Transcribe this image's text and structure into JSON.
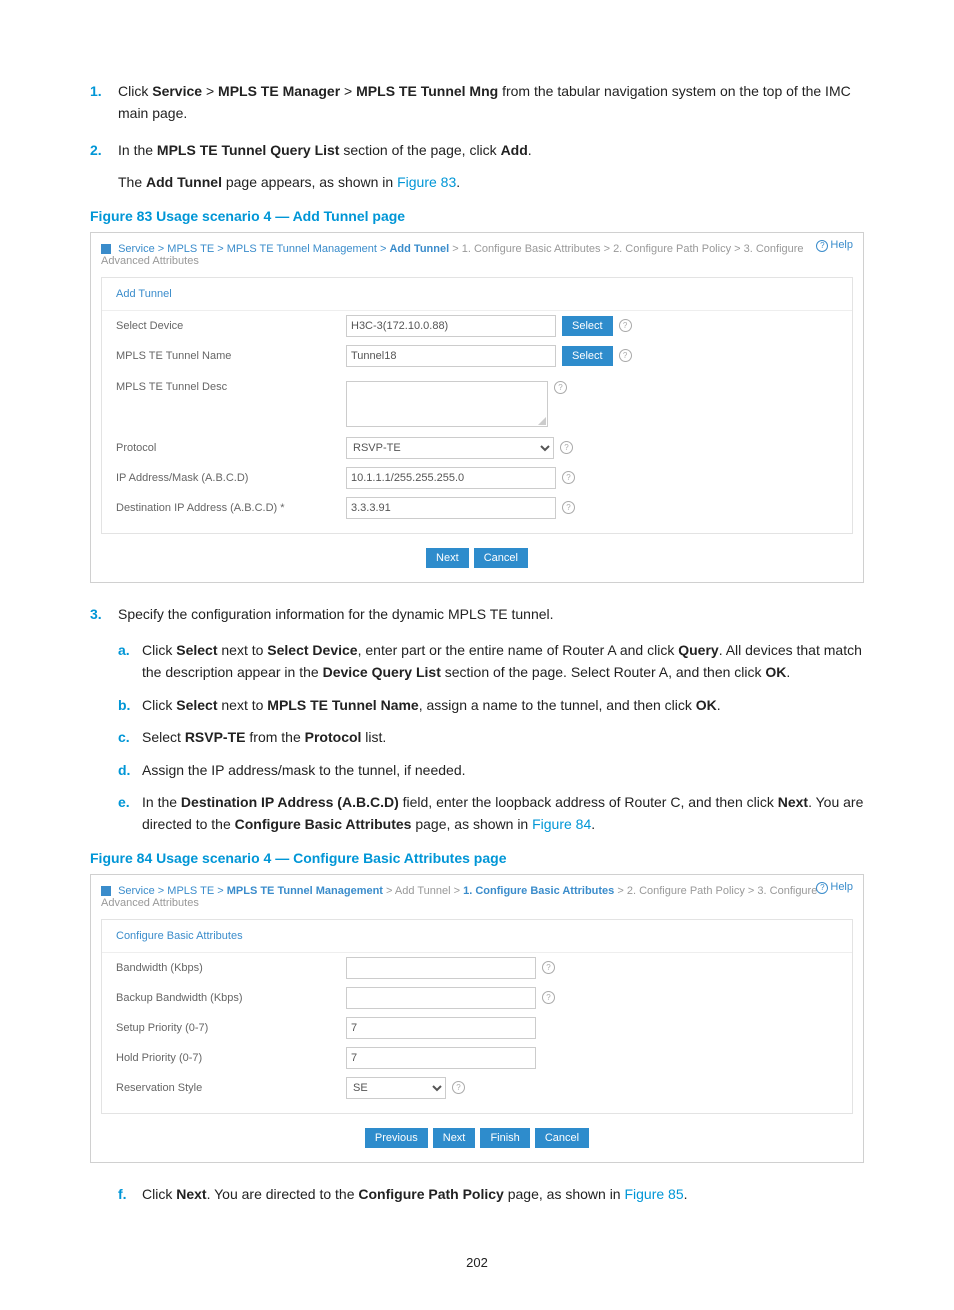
{
  "steps": {
    "s1_pre": "Click ",
    "s1_b1": "Service",
    "s1_gt1": " > ",
    "s1_b2": "MPLS TE Manager",
    "s1_gt2": " > ",
    "s1_b3": "MPLS TE Tunnel Mng",
    "s1_post": " from the tabular navigation system on the top of the IMC main page.",
    "s2_pre": "In the ",
    "s2_b1": "MPLS TE Tunnel Query List",
    "s2_mid": " section of the page, click ",
    "s2_b2": "Add",
    "s2_post": ".",
    "s2_line2_pre": "The ",
    "s2_line2_b": "Add Tunnel",
    "s2_line2_mid": " page appears, as shown in ",
    "s2_line2_link": "Figure 83",
    "s2_line2_post": ".",
    "s3": "Specify the configuration information for the dynamic MPLS TE tunnel.",
    "sa_pre": "Click ",
    "sa_b1": "Select",
    "sa_mid1": " next to ",
    "sa_b2": "Select Device",
    "sa_mid2": ", enter part or the entire name of Router A and click ",
    "sa_b3": "Query",
    "sa_mid3": ". All devices that match the description appear in the ",
    "sa_b4": "Device Query List",
    "sa_mid4": " section of the page. Select Router A, and then click ",
    "sa_b5": "OK",
    "sa_post": ".",
    "sb_pre": "Click ",
    "sb_b1": "Select",
    "sb_mid1": " next to ",
    "sb_b2": "MPLS TE Tunnel Name",
    "sb_mid2": ", assign a name to the tunnel, and then click ",
    "sb_b3": "OK",
    "sb_post": ".",
    "sc_pre": "Select ",
    "sc_b1": "RSVP-TE",
    "sc_mid": " from the ",
    "sc_b2": "Protocol",
    "sc_post": " list.",
    "sd": "Assign the IP address/mask to the tunnel, if needed.",
    "se_pre": "In the ",
    "se_b1": "Destination IP Address (A.B.C.D)",
    "se_mid1": " field, enter the loopback address of Router C, and then click ",
    "se_b2": "Next",
    "se_mid2": ". You are directed to the ",
    "se_b3": "Configure Basic Attributes",
    "se_mid3": " page, as shown in ",
    "se_link": "Figure 84",
    "se_post": ".",
    "sf_pre": "Click ",
    "sf_b1": "Next",
    "sf_mid1": ". You are directed to the ",
    "sf_b2": "Configure Path Policy",
    "sf_mid2": " page, as shown in ",
    "sf_link": "Figure 85",
    "sf_post": "."
  },
  "nums": {
    "n1": "1.",
    "n2": "2.",
    "n3": "3.",
    "na": "a.",
    "nb": "b.",
    "nc": "c.",
    "nd": "d.",
    "ne": "e.",
    "nf": "f."
  },
  "fig83": {
    "caption": "Figure 83 Usage scenario 4 — Add Tunnel page",
    "crumbs": {
      "c1": "Service",
      "c2": "MPLS TE",
      "c3": "MPLS TE Tunnel Management",
      "c4": "Add Tunnel",
      "c5": "1. Configure Basic Attributes",
      "c6": "2. Configure Path Policy",
      "c7": "3. Configure Advanced Attributes"
    },
    "help": "Help",
    "panel_title": "Add Tunnel",
    "labels": {
      "device": "Select Device",
      "tname": "MPLS TE Tunnel Name",
      "tdesc": "MPLS TE Tunnel Desc",
      "protocol": "Protocol",
      "ipmask": "IP Address/Mask (A.B.C.D)",
      "dest": "Destination IP Address (A.B.C.D) *"
    },
    "values": {
      "device": "H3C-3(172.10.0.88)",
      "tname": "Tunnel18",
      "protocol": "RSVP-TE",
      "ipmask": "10.1.1.1/255.255.255.0",
      "dest": "3.3.3.91"
    },
    "buttons": {
      "select": "Select",
      "next": "Next",
      "cancel": "Cancel"
    }
  },
  "fig84": {
    "caption": "Figure 84 Usage scenario 4 — Configure Basic Attributes page",
    "crumbs": {
      "c1": "Service",
      "c2": "MPLS TE",
      "c3": "MPLS TE Tunnel Management",
      "c4": "Add Tunnel",
      "c5": "1. Configure Basic Attributes",
      "c6": "2. Configure Path Policy",
      "c7": "3. Configure Advanced Attributes"
    },
    "help": "Help",
    "panel_title": "Configure Basic Attributes",
    "labels": {
      "bw": "Bandwidth (Kbps)",
      "bbw": "Backup Bandwidth (Kbps)",
      "setup": "Setup Priority (0-7)",
      "hold": "Hold Priority (0-7)",
      "res": "Reservation Style"
    },
    "values": {
      "setup": "7",
      "hold": "7",
      "res": "SE"
    },
    "buttons": {
      "previous": "Previous",
      "next": "Next",
      "finish": "Finish",
      "cancel": "Cancel"
    }
  },
  "page_number": "202"
}
